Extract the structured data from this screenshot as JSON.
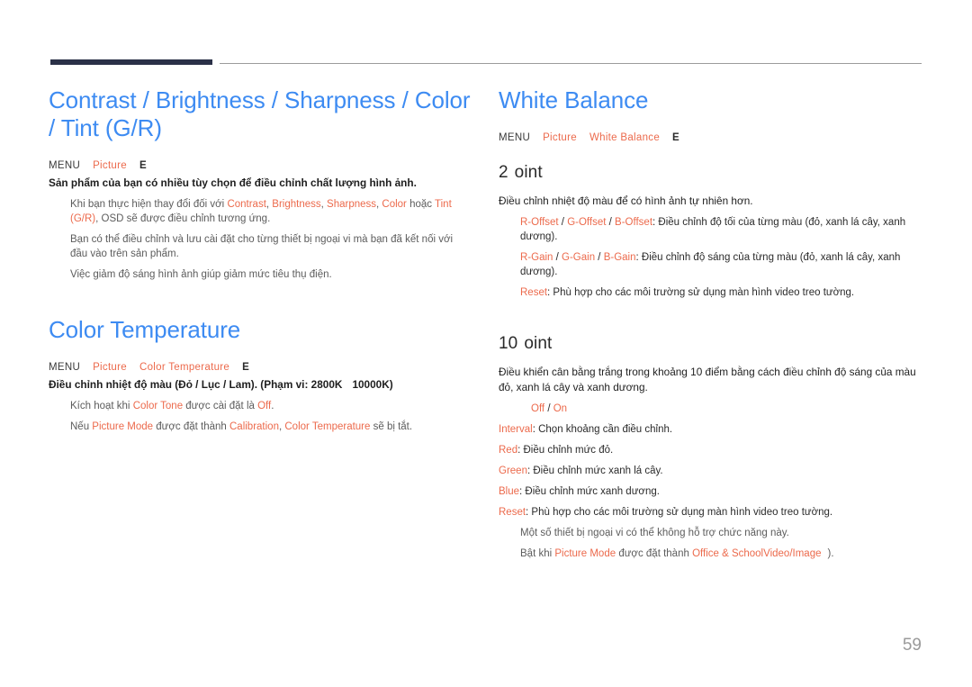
{
  "page": {
    "number": "59",
    "accent_blue": "#3d8bf2",
    "accent_orange": "#ec6a4c",
    "header_bar_color": "#2b3148",
    "header_line_color": "#9b9b9b"
  },
  "left_column": {
    "section1": {
      "title": "Contrast / Brightness / Sharpness / Color / Tint (G/R)",
      "menu": {
        "menu_label": "MENU",
        "path1": "Picture",
        "enter_key": "E"
      },
      "lead": "Sản phẩm của bạn có nhiều tùy chọn để điều chỉnh chất lượng hình ảnh.",
      "bullets": [
        {
          "pre": "Khi bạn thực hiện thay đổi đối với ",
          "hl1": "Contrast",
          "mid1": ", ",
          "hl2": "Brightness",
          "mid2": ", ",
          "hl3": "Sharpness",
          "mid3": ", ",
          "hl4": "Color",
          "mid4": " hoặc ",
          "hl5": "Tint (G/R)",
          "post": ", OSD sẽ được điều chỉnh tương ứng."
        },
        {
          "text": "Bạn có thể điều chỉnh và lưu cài đặt cho từng thiết bị ngoại vi mà bạn đã kết nối với đầu vào trên sản phẩm."
        },
        {
          "text": "Việc giảm độ sáng hình ảnh giúp giảm mức tiêu thụ điện."
        }
      ]
    },
    "section2": {
      "title": "Color Temperature",
      "menu": {
        "menu_label": "MENU",
        "path1": "Picture",
        "path2": "Color Temperature",
        "enter_key": "E"
      },
      "lead_pre": "Điều chỉnh nhiệt độ màu (Đỏ / Lục / Lam). (Phạm vi: 2800K",
      "lead_post": "10000K)",
      "bullets": [
        {
          "pre": "Kích hoạt khi ",
          "hl1": "Color Tone",
          "mid1": " được cài đặt là ",
          "hl2": "Off",
          "post": "."
        },
        {
          "pre": "Nếu ",
          "hl1": "Picture Mode",
          "mid1": " được đặt thành ",
          "hl2": "Calibration",
          "mid2": ", ",
          "hl3": "Color Temperature",
          "post": " sẽ bị tắt."
        }
      ]
    }
  },
  "right_column": {
    "section1": {
      "title": "White Balance",
      "menu": {
        "menu_label": "MENU",
        "path1": "Picture",
        "path2": "White Balance",
        "enter_key": "E"
      },
      "sub1": {
        "heading_num": "2",
        "heading_word": "oint",
        "lead": "Điều chỉnh nhiệt độ màu để có hình ảnh tự nhiên hơn.",
        "bullets": [
          {
            "hl1": "R-Offset",
            "sep1": " / ",
            "hl2": "G-Offset",
            "sep2": " / ",
            "hl3": "B-Offset",
            "post": ": Điều chỉnh độ tối của từng màu (đỏ, xanh lá cây, xanh dương)."
          },
          {
            "hl1": "R-Gain",
            "sep1": " / ",
            "hl2": "G-Gain",
            "sep2": " / ",
            "hl3": "B-Gain",
            "post": ": Điều chỉnh độ sáng của từng màu (đỏ, xanh lá cây, xanh dương)."
          },
          {
            "hl1": "Reset",
            "post": ": Phù hợp cho các môi trường sử dụng màn hình video treo tường."
          }
        ]
      },
      "sub2": {
        "heading_num": "10",
        "heading_word": "oint",
        "lead": "Điều khiển cân bằng trắng trong khoảng 10 điểm bằng cách điều chỉnh độ sáng của màu đỏ, xanh lá cây và xanh dương.",
        "onoff": {
          "off": "Off",
          "sep": " / ",
          "on": "On"
        },
        "bullets": [
          {
            "hl1": "Interval",
            "post": ": Chọn khoảng cần điều chỉnh."
          },
          {
            "hl1": "Red",
            "post": ": Điều chỉnh mức đỏ."
          },
          {
            "hl1": "Green",
            "post": ": Điều chỉnh mức xanh lá cây."
          },
          {
            "hl1": "Blue",
            "post": ": Điều chỉnh mức xanh dương."
          },
          {
            "hl1": "Reset",
            "post": ": Phù hợp cho các môi trường sử dụng màn hình video treo tường."
          }
        ],
        "notes": [
          {
            "text": "Một số thiết bị ngoại vi có thể không hỗ trợ chức năng này."
          },
          {
            "pre": "Bật khi ",
            "hl1": "Picture Mode",
            "mid1": " được đặt thành ",
            "hl2": "Office & School",
            "hl3": "Video/Image",
            "post": ")."
          }
        ]
      }
    }
  }
}
